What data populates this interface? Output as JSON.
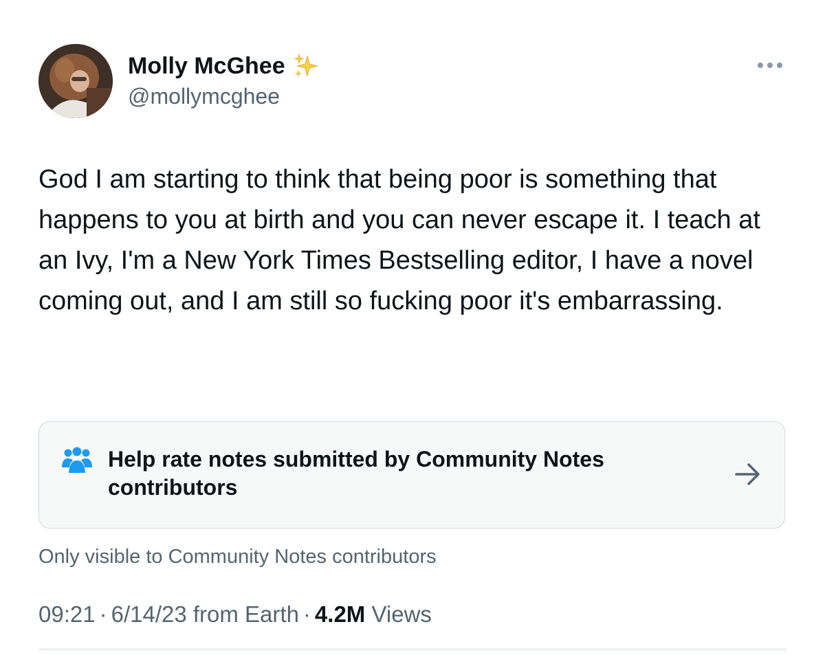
{
  "author": {
    "display_name": "Molly McGhee",
    "handle": "@mollymcghee",
    "badge_icon": "sparkles-icon",
    "avatar_icon": "profile-photo"
  },
  "tweet": {
    "text": "God I am starting to think that being poor is something that happens to you at birth and you can never escape it. I teach at an Ivy, I'm a New York Times Bestselling editor, I have a novel coming out, and I am still so fucking poor it's embarrassing."
  },
  "community_note_prompt": {
    "icon": "people-icon",
    "text": "Help rate notes submitted by Community Notes contributors",
    "arrow_icon": "arrow-right-icon",
    "visibility": "Only visible to Community Notes contributors"
  },
  "meta": {
    "time": "09:21",
    "separator": "·",
    "date": "6/14/23",
    "source": "from Earth",
    "views_count": "4.2M",
    "views_label": "Views"
  },
  "colors": {
    "text_primary": "#0f1419",
    "text_secondary": "#536471",
    "accent_blue": "#1d9bf0",
    "card_background": "#f7f9f9",
    "border": "#cfd9de"
  }
}
